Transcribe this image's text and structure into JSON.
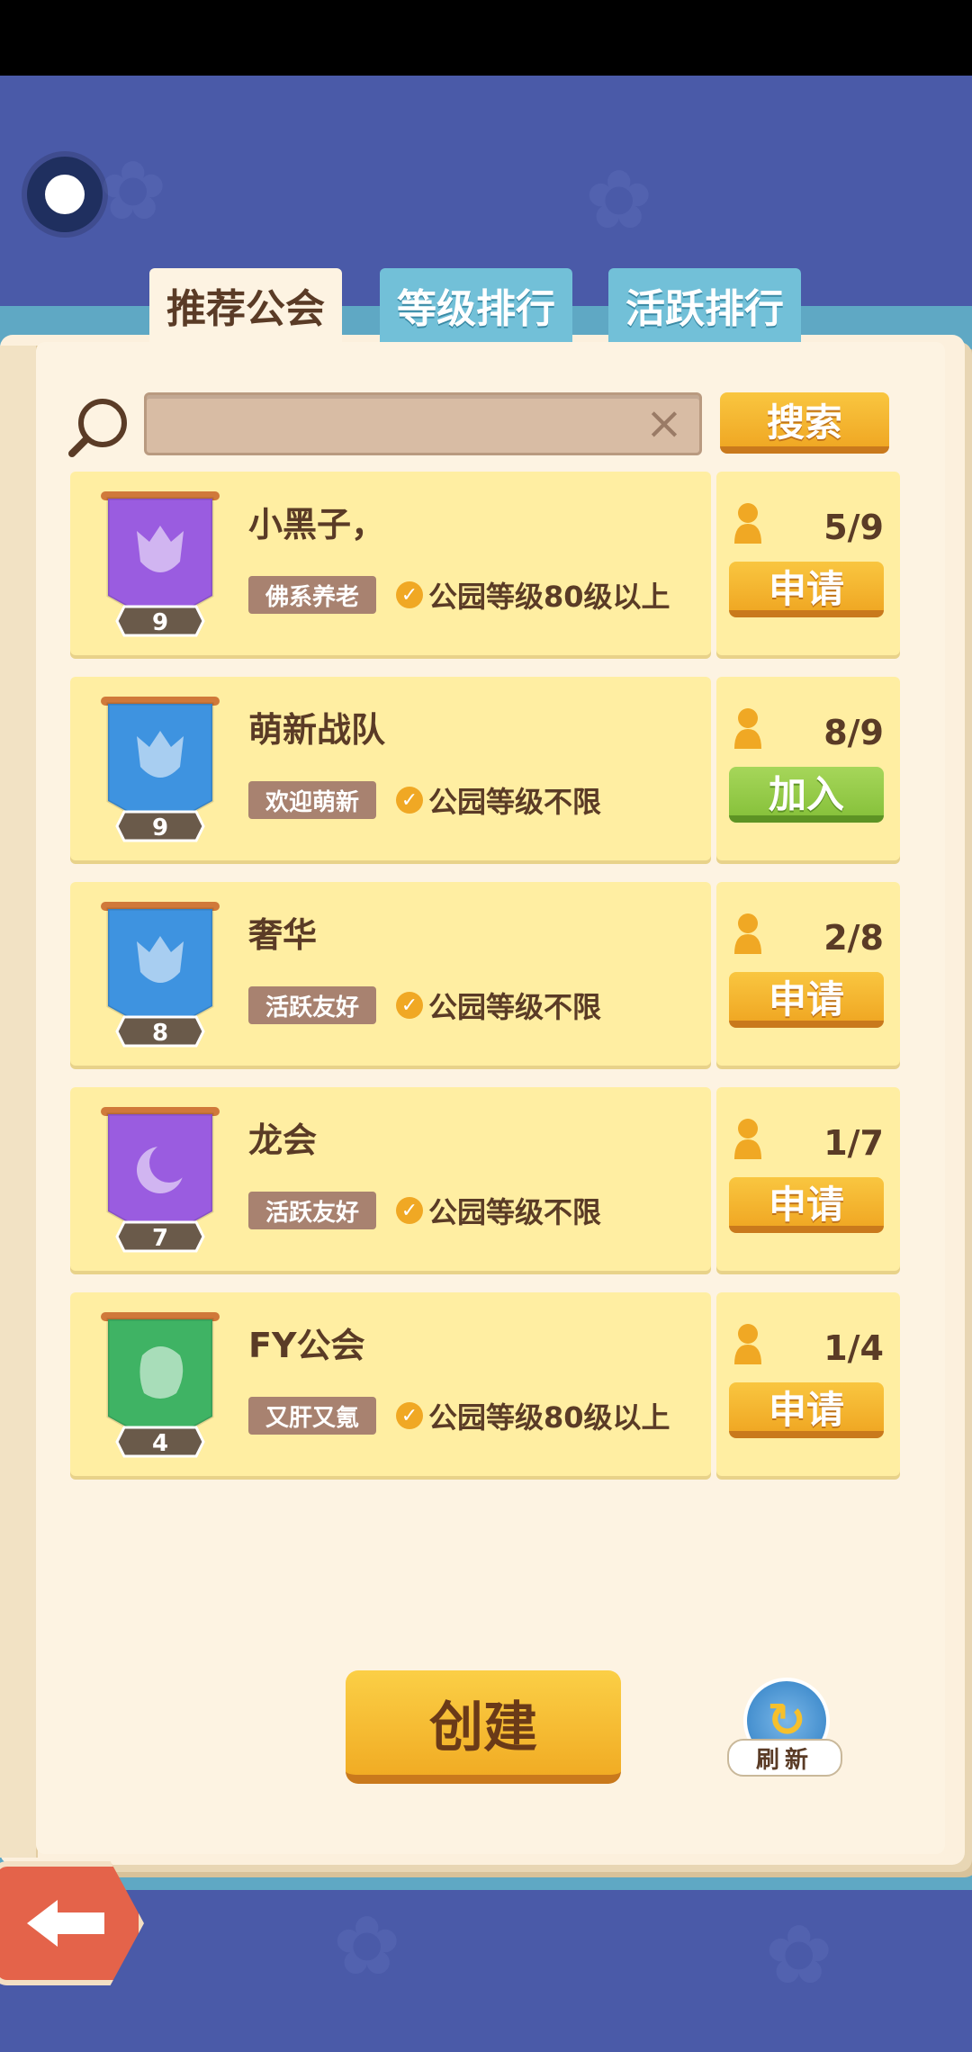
{
  "tabs": [
    {
      "label": "推荐公会",
      "active": true
    },
    {
      "label": "等级排行",
      "active": false
    },
    {
      "label": "活跃排行",
      "active": false
    }
  ],
  "search": {
    "placeholder": "",
    "button_label": "搜索",
    "clear_icon": "close-icon"
  },
  "guilds": [
    {
      "name": "小黑子，",
      "level": "9",
      "tag": "佛系养老",
      "requirement": "公园等级80级以上",
      "members": "5/9",
      "action": "申请",
      "action_color": "orange",
      "banner_color": "#9a5ce0",
      "emblem": "wolf"
    },
    {
      "name": "萌新战队",
      "level": "9",
      "tag": "欢迎萌新",
      "requirement": "公园等级不限",
      "members": "8/9",
      "action": "加入",
      "action_color": "green",
      "banner_color": "#3e93e0",
      "emblem": "wolf"
    },
    {
      "name": "奢华",
      "level": "8",
      "tag": "活跃友好",
      "requirement": "公园等级不限",
      "members": "2/8",
      "action": "申请",
      "action_color": "orange",
      "banner_color": "#3e93e0",
      "emblem": "wolf"
    },
    {
      "name": "龙会",
      "level": "7",
      "tag": "活跃友好",
      "requirement": "公园等级不限",
      "members": "1/7",
      "action": "申请",
      "action_color": "orange",
      "banner_color": "#9a5ce0",
      "emblem": "moon"
    },
    {
      "name": "FY公会",
      "level": "4",
      "tag": "又肝又氪",
      "requirement": "公园等级80级以上",
      "members": "1/4",
      "action": "申请",
      "action_color": "orange",
      "banner_color": "#3fb364",
      "emblem": "lion"
    }
  ],
  "footer": {
    "create_label": "创建",
    "refresh_label": "刷新"
  },
  "colors": {
    "accent_orange": "#f0a824",
    "accent_green": "#88c23c",
    "row_bg": "#ffeea2",
    "text_brown": "#5a3b26"
  }
}
